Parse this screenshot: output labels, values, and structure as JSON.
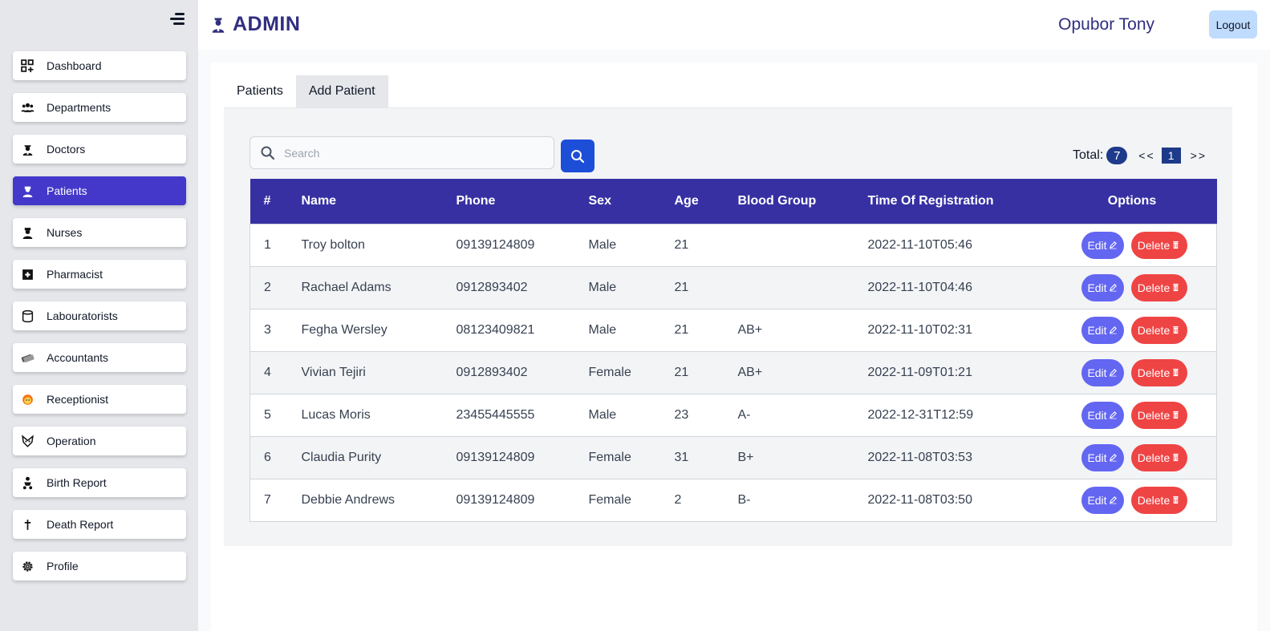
{
  "header": {
    "title": "ADMIN",
    "user_name": "Opubor Tony",
    "logout_label": "Logout"
  },
  "sidebar": {
    "items": [
      {
        "label": "Dashboard",
        "icon": "dashboard-icon"
      },
      {
        "label": "Departments",
        "icon": "group-icon"
      },
      {
        "label": "Doctors",
        "icon": "doctor-icon"
      },
      {
        "label": "Patients",
        "icon": "patient-icon",
        "active": true
      },
      {
        "label": "Nurses",
        "icon": "nurse-icon"
      },
      {
        "label": "Pharmacist",
        "icon": "pharmacy-icon"
      },
      {
        "label": "Labouratorists",
        "icon": "lab-icon"
      },
      {
        "label": "Accountants",
        "icon": "money-icon"
      },
      {
        "label": "Receptionist",
        "icon": "receptionist-icon"
      },
      {
        "label": "Operation",
        "icon": "operation-icon"
      },
      {
        "label": "Birth Report",
        "icon": "baby-icon"
      },
      {
        "label": "Death Report",
        "icon": "cross-icon"
      },
      {
        "label": "Profile",
        "icon": "gear-icon"
      }
    ]
  },
  "tabs": [
    {
      "label": "Patients",
      "active": false
    },
    {
      "label": "Add Patient",
      "active": true
    }
  ],
  "search": {
    "placeholder": "Search",
    "value": ""
  },
  "pagination": {
    "total_label": "Total:",
    "total": "7",
    "prev": "<<",
    "page": "1",
    "next": ">>"
  },
  "table": {
    "columns": [
      "#",
      "Name",
      "Phone",
      "Sex",
      "Age",
      "Blood Group",
      "Time Of Registration",
      "Options"
    ],
    "rows": [
      {
        "idx": "1",
        "name": "Troy bolton",
        "phone": "09139124809",
        "sex": "Male",
        "age": "21",
        "blood": "",
        "time": "2022-11-10T05:46"
      },
      {
        "idx": "2",
        "name": "Rachael Adams",
        "phone": "0912893402",
        "sex": "Male",
        "age": "21",
        "blood": "",
        "time": "2022-11-10T04:46"
      },
      {
        "idx": "3",
        "name": "Fegha Wersley",
        "phone": "08123409821",
        "sex": "Male",
        "age": "21",
        "blood": "AB+",
        "time": "2022-11-10T02:31"
      },
      {
        "idx": "4",
        "name": "Vivian Tejiri",
        "phone": "0912893402",
        "sex": "Female",
        "age": "21",
        "blood": "AB+",
        "time": "2022-11-09T01:21"
      },
      {
        "idx": "5",
        "name": "Lucas Moris",
        "phone": "23455445555",
        "sex": "Male",
        "age": "23",
        "blood": "A-",
        "time": "2022-12-31T12:59"
      },
      {
        "idx": "6",
        "name": "Claudia Purity",
        "phone": "09139124809",
        "sex": "Female",
        "age": "31",
        "blood": "B+",
        "time": "2022-11-08T03:53"
      },
      {
        "idx": "7",
        "name": "Debbie Andrews",
        "phone": "09139124809",
        "sex": "Female",
        "age": "2",
        "blood": "B-",
        "time": "2022-11-08T03:50"
      }
    ],
    "edit_label": "Edit",
    "delete_label": "Delete"
  }
}
